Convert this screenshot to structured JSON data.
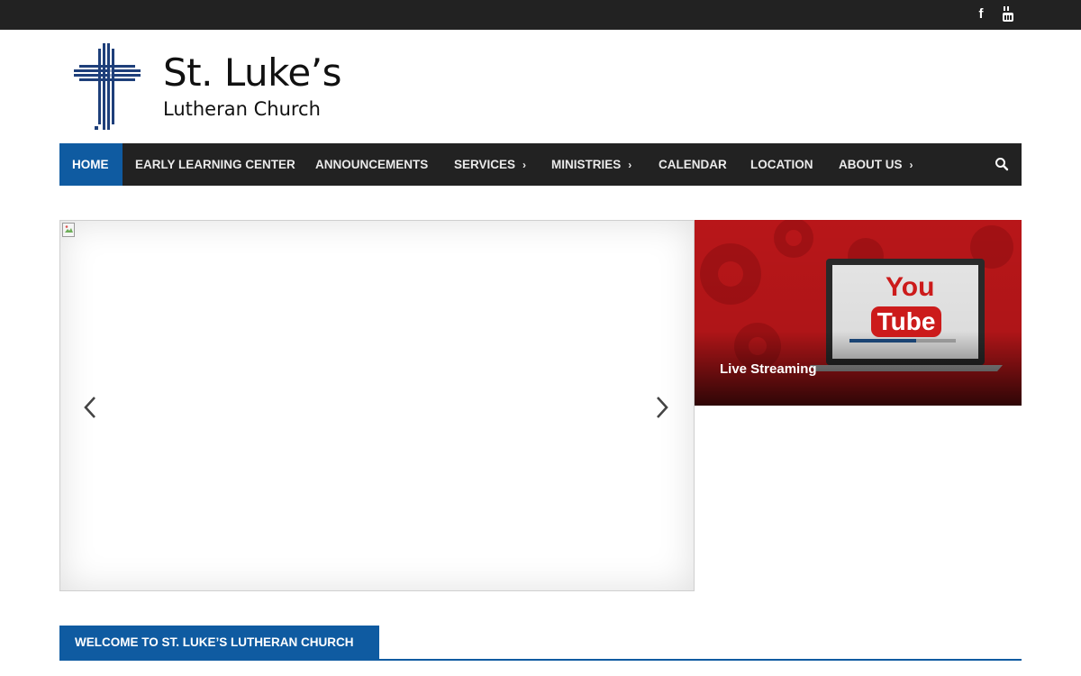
{
  "topbar": {
    "social": [
      {
        "name": "facebook-icon",
        "glyph": "f"
      },
      {
        "name": "youtube-icon"
      }
    ]
  },
  "brand": {
    "name": "St. Luke’s",
    "subtitle": "Lutheran Church"
  },
  "nav": {
    "items": [
      {
        "label": "HOME",
        "active": true,
        "has_submenu": false
      },
      {
        "label": "EARLY LEARNING CENTER",
        "active": false,
        "has_submenu": false
      },
      {
        "label": "ANNOUNCEMENTS",
        "active": false,
        "has_submenu": false
      },
      {
        "label": "SERVICES",
        "active": false,
        "has_submenu": true
      },
      {
        "label": "MINISTRIES",
        "active": false,
        "has_submenu": true
      },
      {
        "label": "CALENDAR",
        "active": false,
        "has_submenu": false
      },
      {
        "label": "LOCATION",
        "active": false,
        "has_submenu": false
      },
      {
        "label": "ABOUT US",
        "active": false,
        "has_submenu": true
      }
    ],
    "submenu_glyph": "›",
    "search_icon": "search-icon"
  },
  "featured": {
    "title": "Live Streaming",
    "thumbnail_text_top": "You",
    "thumbnail_text_bottom": "Tube"
  },
  "welcome": {
    "heading": "WELCOME TO ST. LUKE’S LUTHERAN CHURCH"
  },
  "colors": {
    "topbar": "#222222",
    "nav_background": "#222222",
    "accent_blue": "#0f5ba1",
    "youtube_red": "#cc1b1b"
  }
}
